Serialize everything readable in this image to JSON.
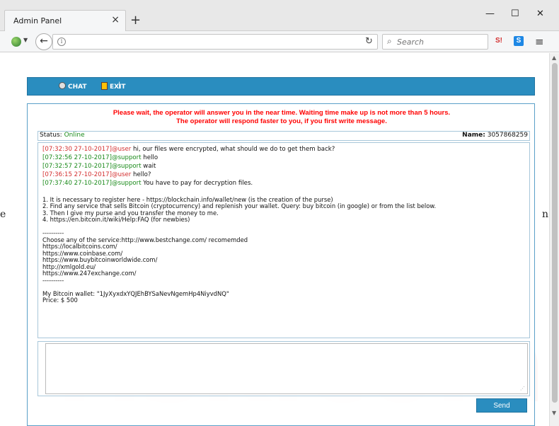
{
  "browser": {
    "tab_title": "Admin Panel",
    "tab_close": "×",
    "new_tab": "+",
    "minimize": "—",
    "maximize": "☐",
    "close": "✕",
    "back": "←",
    "info": "i",
    "url": "",
    "reload": "↻",
    "search_placeholder": "Search",
    "search_icon": "⌕",
    "menu": "≡",
    "ext1": "S!",
    "ext2": "S"
  },
  "topbar": {
    "chat_label": "CHAT",
    "separator": "|",
    "exit_label": "EXIT"
  },
  "watermark": "PC risk.com",
  "notice": {
    "line1": "Please wait, the operator will answer you in the near time. Waiting time make up is not more than 5 hours.",
    "line2": "The operator will respond faster to you, if you first write message."
  },
  "status": {
    "label": "Status:",
    "value": "Online",
    "name_label": "Name:",
    "name_value": "3057868259"
  },
  "messages": [
    {
      "ts": "[07:32:30 27-10-2017]@user",
      "role": "user",
      "text": " hi, our files were encrypted, what should we do to get them back?"
    },
    {
      "ts": "[07:32:56 27-10-2017]@support",
      "role": "support",
      "text": " hello"
    },
    {
      "ts": "[07:32:57 27-10-2017]@support",
      "role": "support",
      "text": " wait"
    },
    {
      "ts": "[07:36:15 27-10-2017]@user",
      "role": "user",
      "text": " hello?"
    },
    {
      "ts": "[07:37:40 27-10-2017]@support",
      "role": "support",
      "text": " You have to pay for decryption files."
    }
  ],
  "body_lines": [
    "",
    "1. It is necessary to register here - https://blockchain.info/wallet/new (is the creation of the purse)",
    "2. Find any service that sells Bitcoin (cryptocurrency) and replenish your wallet. Query: buy bitcoin (in google) or from the list below.",
    "3. Then I give my purse and you transfer the money to me.",
    "4. https://en.bitcoin.it/wiki/Help:FAQ (for newbies)",
    "",
    "----------",
    "Choose any of the service:http://www.bestchange.com/ recomemded",
    "https://localbitcoins.com/",
    "https://www.coinbase.com/",
    "https://www.buybitcoinworldwide.com/",
    "http://xmlgold.eu/",
    "https://www.247exchange.com/",
    "----------",
    "",
    "My Bitcoin wallet: \"1JyXyxdxYQJEhBYSaNevNgemHp4NiyvdNQ\"",
    "Price: $ 500"
  ],
  "send_label": "Send",
  "edge_left": "e",
  "edge_right": "n"
}
